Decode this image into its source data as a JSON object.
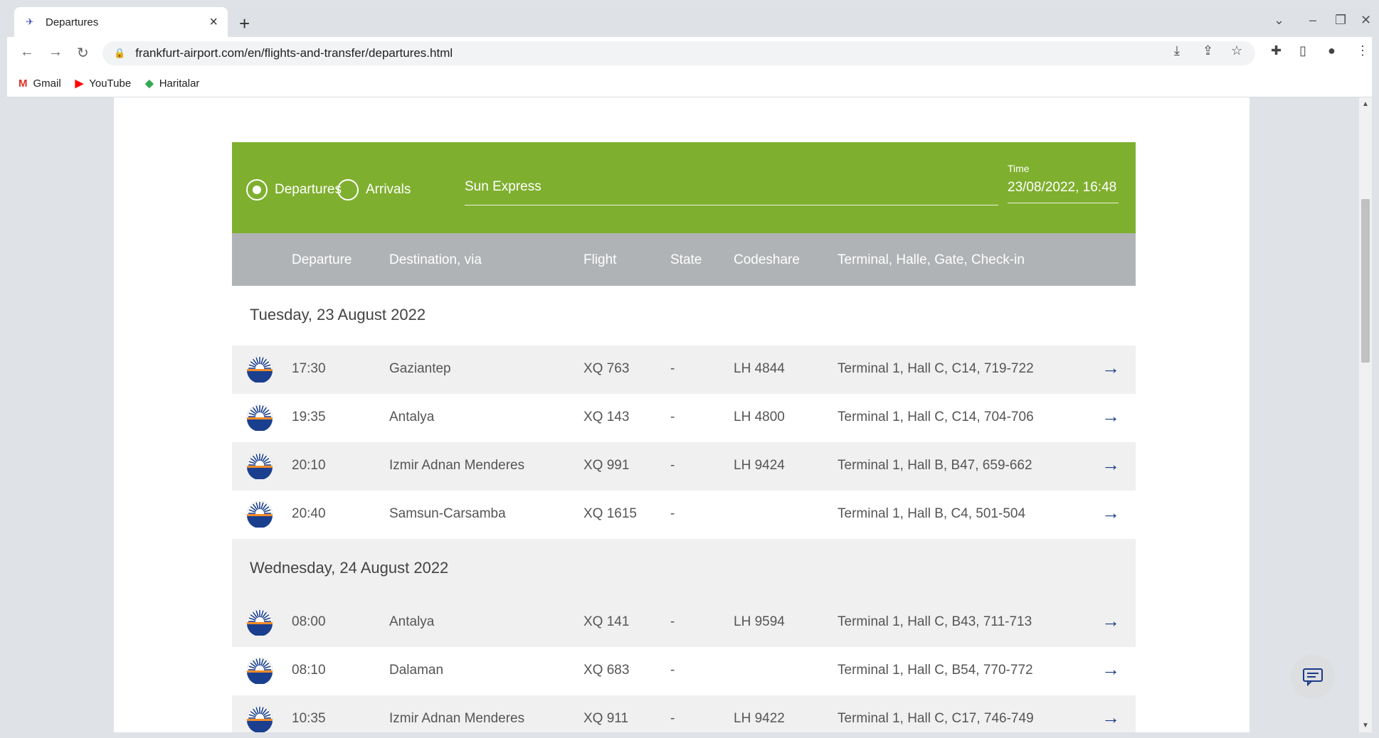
{
  "browser": {
    "tab_title": "Departures",
    "url": "frankfurt-airport.com/en/flights-and-transfer/departures.html",
    "bookmarks": [
      "Gmail",
      "YouTube",
      "Haritalar"
    ]
  },
  "filter": {
    "departures_label": "Departures",
    "arrivals_label": "Arrivals",
    "selected": "Departures",
    "airline_value": "Sun Express",
    "time_label": "Time",
    "time_value": "23/08/2022, 16:48"
  },
  "columns": {
    "departure": "Departure",
    "destination": "Destination, via",
    "flight": "Flight",
    "state": "State",
    "codeshare": "Codeshare",
    "terminal": "Terminal, Halle, Gate, Check-in"
  },
  "days": [
    {
      "date": "Tuesday, 23 August 2022",
      "flights": [
        {
          "time": "17:30",
          "destination": "Gaziantep",
          "flight": "XQ 763",
          "state": "-",
          "codeshare": "LH 4844",
          "terminal": "Terminal 1, Hall C, C14, 719-722"
        },
        {
          "time": "19:35",
          "destination": "Antalya",
          "flight": "XQ 143",
          "state": "-",
          "codeshare": "LH 4800",
          "terminal": "Terminal 1, Hall C, C14, 704-706"
        },
        {
          "time": "20:10",
          "destination": "Izmir Adnan Menderes",
          "flight": "XQ 991",
          "state": "-",
          "codeshare": "LH 9424",
          "terminal": "Terminal 1, Hall B, B47, 659-662"
        },
        {
          "time": "20:40",
          "destination": "Samsun-Carsamba",
          "flight": "XQ 1615",
          "state": "-",
          "codeshare": "",
          "terminal": "Terminal 1, Hall B, C4, 501-504"
        }
      ]
    },
    {
      "date": "Wednesday, 24 August 2022",
      "flights": [
        {
          "time": "08:00",
          "destination": "Antalya",
          "flight": "XQ 141",
          "state": "-",
          "codeshare": "LH 9594",
          "terminal": "Terminal 1, Hall C, B43, 711-713"
        },
        {
          "time": "08:10",
          "destination": "Dalaman",
          "flight": "XQ 683",
          "state": "-",
          "codeshare": "",
          "terminal": "Terminal 1, Hall C, B54, 770-772"
        },
        {
          "time": "10:35",
          "destination": "Izmir Adnan Menderes",
          "flight": "XQ 911",
          "state": "-",
          "codeshare": "LH 9422",
          "terminal": "Terminal 1, Hall C, C17, 746-749"
        }
      ]
    }
  ],
  "colors": {
    "filter_bg": "#7faf2f",
    "header_bg": "#b0b3b5",
    "arrow": "#1a3a8a"
  }
}
